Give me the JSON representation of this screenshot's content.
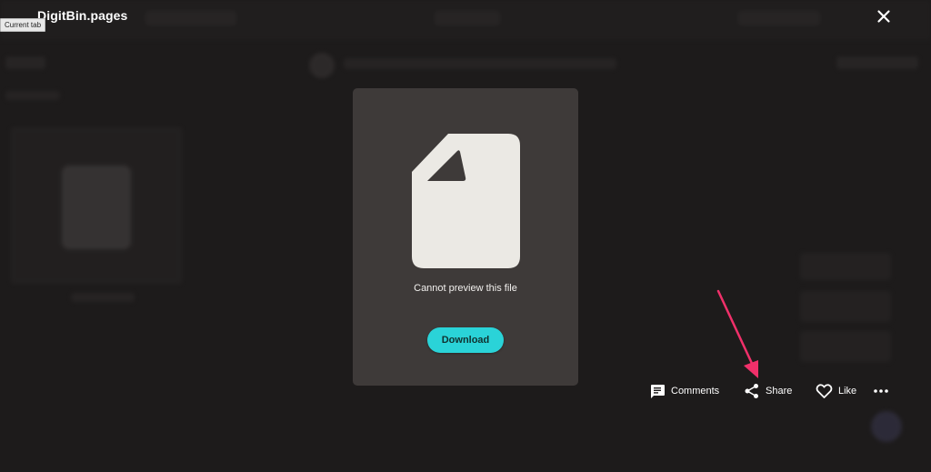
{
  "header": {
    "brand": "DigitBin.pages",
    "tooltip": "Current tab"
  },
  "viewer": {
    "message": "Cannot preview this file",
    "download_label": "Download"
  },
  "actions": {
    "comments_label": "Comments",
    "share_label": "Share",
    "like_label": "Like"
  },
  "icons": {
    "close": "close-icon",
    "file": "file-icon",
    "comments": "comment-icon",
    "share": "share-icon",
    "like": "heart-icon",
    "more": "more-horizontal-icon",
    "annotation": "arrow-annotation"
  },
  "colors": {
    "download_button": "#2ad3d8",
    "annotation_arrow": "#f0306a",
    "card_background": "#3e3a39"
  }
}
